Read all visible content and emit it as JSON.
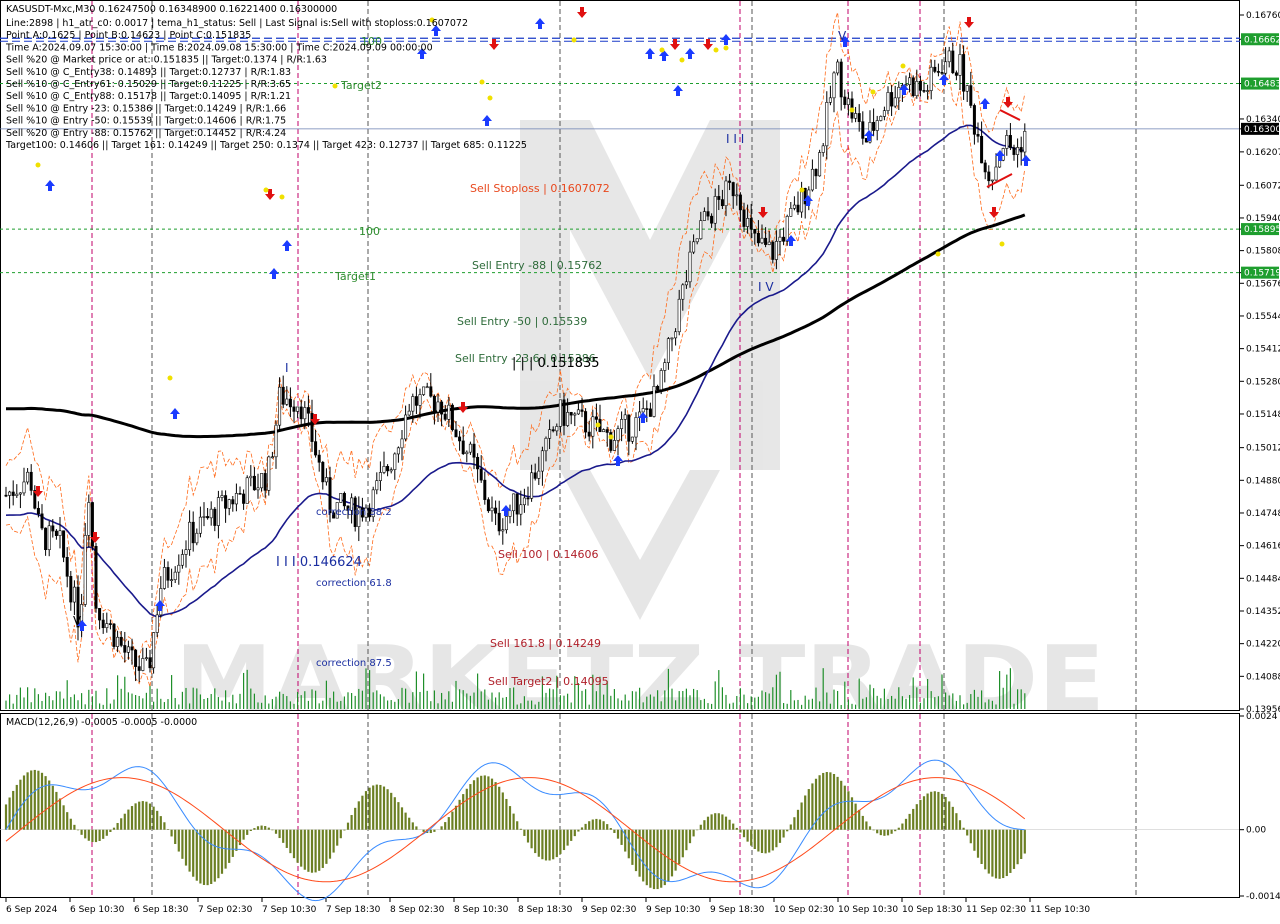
{
  "chart_data": {
    "type": "candlestick",
    "symbol": "KASUSDT-Mxc,M30",
    "ohlc": "0.16247500 0.16348900 0.16221400 0.16300000",
    "info_lines": [
      "Line:2898 | h1_atr_c0: 0.0017 | tema_h1_status: Sell | Last Signal is:Sell with stoploss:0.1607072",
      "Point A:0.1625 | Point B:0.14623 | Point C:0.151835",
      "Time A:2024.09.07 15:30:00 | Time B:2024.09.08 15:30:00 | Time C:2024.09.09 00:00:00",
      "Sell %20 @ Market price or at: 0.151835 || Target:0.1374 | R/R:1.63",
      "Sell %10 @ C_Entry38: 0.14893 || Target:0.12737 | R/R:1.83",
      "Sell %10 @ C_Entry61: 0.15029 || Target:0.11225 | R/R:3.65",
      "Sell %10 @ C_Entry88: 0.15178 || Target:0.14095 | R/R:1.21",
      "Sell %10 @ Entry -23: 0.15386 || Target:0.14249 | R/R:1.66",
      "Sell %10 @ Entry -50: 0.15539 || Target:0.14606 | R/R:1.75",
      "Sell %20 @ Entry -88: 0.15762 || Target:0.14452 | R/R:4.24",
      "Target100: 0.14606 || Target 161: 0.14249 || Target 250: 0.1374 || Target 423: 0.12737 || Target 685: 0.11225"
    ],
    "price_axis": {
      "min": 0.13956,
      "max": 0.1676,
      "ticks": [
        "0.16760",
        "0.16662",
        "0.16483",
        "0.16340",
        "0.16300",
        "0.16207",
        "0.16072",
        "0.15940",
        "0.15895",
        "0.15808",
        "0.15719",
        "0.15676",
        "0.15544",
        "0.15412",
        "0.15280",
        "0.15148",
        "0.15012",
        "0.14880",
        "0.14748",
        "0.14616",
        "0.14484",
        "0.14352",
        "0.14220",
        "0.14088",
        "0.13956"
      ],
      "highlighted": [
        {
          "value": "0.16662",
          "color": "#1e9e2e"
        },
        {
          "value": "0.16483",
          "color": "#1e9e2e"
        },
        {
          "value": "0.16300",
          "color": "#000000"
        },
        {
          "value": "0.15895",
          "color": "#1e9e2e"
        },
        {
          "value": "0.15719",
          "color": "#1e9e2e"
        }
      ]
    },
    "time_axis": [
      "6 Sep 2024",
      "6 Sep 10:30",
      "6 Sep 18:30",
      "7 Sep 02:30",
      "7 Sep 10:30",
      "7 Sep 18:30",
      "8 Sep 02:30",
      "8 Sep 10:30",
      "8 Sep 18:30",
      "9 Sep 02:30",
      "9 Sep 10:30",
      "9 Sep 18:30",
      "10 Sep 02:30",
      "10 Sep 10:30",
      "10 Sep 18:30",
      "11 Sep 02:30",
      "11 Sep 10:30"
    ],
    "levels": [
      {
        "label": "Sell Stoploss | 0.1607072",
        "color": "#e8471c"
      },
      {
        "label": "Sell Entry -88 | 0.15762",
        "color": "#2e6b3a"
      },
      {
        "label": "Sell Entry -50 | 0.15539",
        "color": "#2e6b3a"
      },
      {
        "label": "Sell Entry -23.6 | 0.15386",
        "color": "#2e6b3a"
      },
      {
        "label": "Sell 100 | 0.14606",
        "color": "#b0202a"
      },
      {
        "label": "Sell 161.8 | 0.14249",
        "color": "#b0202a"
      },
      {
        "label": "Sell Target2 | 0.14095",
        "color": "#b0202a"
      },
      {
        "label": "| | | 0.151835",
        "color": "#000000"
      },
      {
        "label": "I I I 0.146624",
        "color": "#1a2ea0"
      },
      {
        "label": "Target2",
        "color": "#2e8b2e"
      },
      {
        "label": "Target1",
        "color": "#2e8b2e"
      },
      {
        "label": "100",
        "color": "#2e8b2e"
      },
      {
        "label": "100",
        "color": "#2e8b2e"
      },
      {
        "label": "correction 38.2",
        "color": "#1a2ea0"
      },
      {
        "label": "correction 61.8",
        "color": "#1a2ea0"
      },
      {
        "label": "correction 87.5",
        "color": "#1a2ea0"
      },
      {
        "label": "I",
        "color": "#1a2ea0"
      },
      {
        "label": "I I I",
        "color": "#1a2ea0"
      },
      {
        "label": "I V",
        "color": "#1a2ea0"
      },
      {
        "label": "V",
        "color": "#000000"
      },
      {
        "label": "V",
        "color": "#1a2ea0"
      }
    ],
    "watermark": "MARKETZ TRADE",
    "macd": {
      "title": "MACD(12,26,9) -0.0005 -0.0005 -0.0000",
      "ticks": [
        "0.0024",
        "0.00",
        "-0.0014"
      ],
      "range": [
        -0.0014,
        0.0024
      ]
    },
    "colors": {
      "bull": "#1f8f2a",
      "bear": "#c01a1a",
      "ma_fast": "#1a1a8c",
      "ma_slow": "#000000",
      "channel": "#ff6a1a",
      "arrow_up": "#1a3bff",
      "arrow_down": "#e01010",
      "histogram": "#6b7f23",
      "macd_line": "#3a8cff",
      "signal_line": "#ff4a1a",
      "level_line": "#1e9e2e",
      "blue_dash": "#1a3bc8"
    }
  }
}
